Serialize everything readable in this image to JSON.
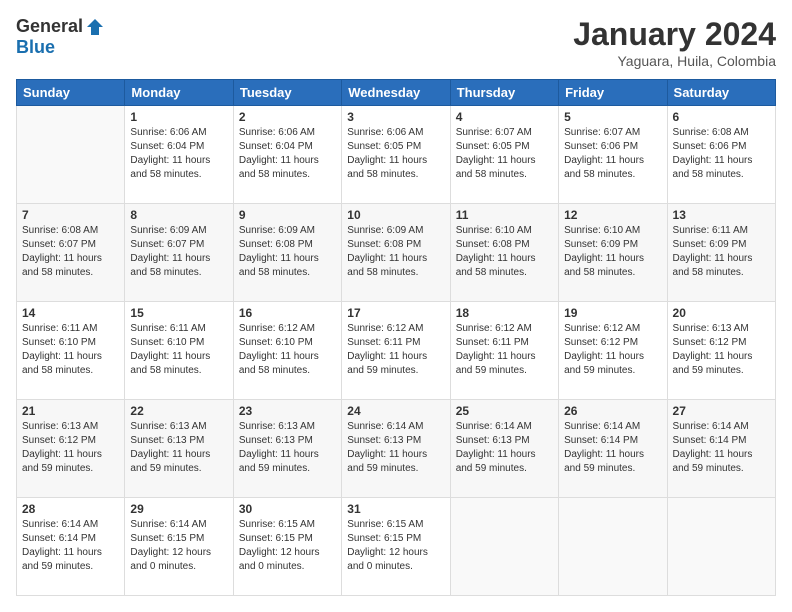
{
  "header": {
    "logo_general": "General",
    "logo_blue": "Blue",
    "month_title": "January 2024",
    "location": "Yaguara, Huila, Colombia"
  },
  "calendar": {
    "days_of_week": [
      "Sunday",
      "Monday",
      "Tuesday",
      "Wednesday",
      "Thursday",
      "Friday",
      "Saturday"
    ],
    "weeks": [
      [
        {
          "day": "",
          "info": ""
        },
        {
          "day": "1",
          "info": "Sunrise: 6:06 AM\nSunset: 6:04 PM\nDaylight: 11 hours\nand 58 minutes."
        },
        {
          "day": "2",
          "info": "Sunrise: 6:06 AM\nSunset: 6:04 PM\nDaylight: 11 hours\nand 58 minutes."
        },
        {
          "day": "3",
          "info": "Sunrise: 6:06 AM\nSunset: 6:05 PM\nDaylight: 11 hours\nand 58 minutes."
        },
        {
          "day": "4",
          "info": "Sunrise: 6:07 AM\nSunset: 6:05 PM\nDaylight: 11 hours\nand 58 minutes."
        },
        {
          "day": "5",
          "info": "Sunrise: 6:07 AM\nSunset: 6:06 PM\nDaylight: 11 hours\nand 58 minutes."
        },
        {
          "day": "6",
          "info": "Sunrise: 6:08 AM\nSunset: 6:06 PM\nDaylight: 11 hours\nand 58 minutes."
        }
      ],
      [
        {
          "day": "7",
          "info": "Sunrise: 6:08 AM\nSunset: 6:07 PM\nDaylight: 11 hours\nand 58 minutes."
        },
        {
          "day": "8",
          "info": "Sunrise: 6:09 AM\nSunset: 6:07 PM\nDaylight: 11 hours\nand 58 minutes."
        },
        {
          "day": "9",
          "info": "Sunrise: 6:09 AM\nSunset: 6:08 PM\nDaylight: 11 hours\nand 58 minutes."
        },
        {
          "day": "10",
          "info": "Sunrise: 6:09 AM\nSunset: 6:08 PM\nDaylight: 11 hours\nand 58 minutes."
        },
        {
          "day": "11",
          "info": "Sunrise: 6:10 AM\nSunset: 6:08 PM\nDaylight: 11 hours\nand 58 minutes."
        },
        {
          "day": "12",
          "info": "Sunrise: 6:10 AM\nSunset: 6:09 PM\nDaylight: 11 hours\nand 58 minutes."
        },
        {
          "day": "13",
          "info": "Sunrise: 6:11 AM\nSunset: 6:09 PM\nDaylight: 11 hours\nand 58 minutes."
        }
      ],
      [
        {
          "day": "14",
          "info": "Sunrise: 6:11 AM\nSunset: 6:10 PM\nDaylight: 11 hours\nand 58 minutes."
        },
        {
          "day": "15",
          "info": "Sunrise: 6:11 AM\nSunset: 6:10 PM\nDaylight: 11 hours\nand 58 minutes."
        },
        {
          "day": "16",
          "info": "Sunrise: 6:12 AM\nSunset: 6:10 PM\nDaylight: 11 hours\nand 58 minutes."
        },
        {
          "day": "17",
          "info": "Sunrise: 6:12 AM\nSunset: 6:11 PM\nDaylight: 11 hours\nand 59 minutes."
        },
        {
          "day": "18",
          "info": "Sunrise: 6:12 AM\nSunset: 6:11 PM\nDaylight: 11 hours\nand 59 minutes."
        },
        {
          "day": "19",
          "info": "Sunrise: 6:12 AM\nSunset: 6:12 PM\nDaylight: 11 hours\nand 59 minutes."
        },
        {
          "day": "20",
          "info": "Sunrise: 6:13 AM\nSunset: 6:12 PM\nDaylight: 11 hours\nand 59 minutes."
        }
      ],
      [
        {
          "day": "21",
          "info": "Sunrise: 6:13 AM\nSunset: 6:12 PM\nDaylight: 11 hours\nand 59 minutes."
        },
        {
          "day": "22",
          "info": "Sunrise: 6:13 AM\nSunset: 6:13 PM\nDaylight: 11 hours\nand 59 minutes."
        },
        {
          "day": "23",
          "info": "Sunrise: 6:13 AM\nSunset: 6:13 PM\nDaylight: 11 hours\nand 59 minutes."
        },
        {
          "day": "24",
          "info": "Sunrise: 6:14 AM\nSunset: 6:13 PM\nDaylight: 11 hours\nand 59 minutes."
        },
        {
          "day": "25",
          "info": "Sunrise: 6:14 AM\nSunset: 6:13 PM\nDaylight: 11 hours\nand 59 minutes."
        },
        {
          "day": "26",
          "info": "Sunrise: 6:14 AM\nSunset: 6:14 PM\nDaylight: 11 hours\nand 59 minutes."
        },
        {
          "day": "27",
          "info": "Sunrise: 6:14 AM\nSunset: 6:14 PM\nDaylight: 11 hours\nand 59 minutes."
        }
      ],
      [
        {
          "day": "28",
          "info": "Sunrise: 6:14 AM\nSunset: 6:14 PM\nDaylight: 11 hours\nand 59 minutes."
        },
        {
          "day": "29",
          "info": "Sunrise: 6:14 AM\nSunset: 6:15 PM\nDaylight: 12 hours\nand 0 minutes."
        },
        {
          "day": "30",
          "info": "Sunrise: 6:15 AM\nSunset: 6:15 PM\nDaylight: 12 hours\nand 0 minutes."
        },
        {
          "day": "31",
          "info": "Sunrise: 6:15 AM\nSunset: 6:15 PM\nDaylight: 12 hours\nand 0 minutes."
        },
        {
          "day": "",
          "info": ""
        },
        {
          "day": "",
          "info": ""
        },
        {
          "day": "",
          "info": ""
        }
      ]
    ]
  }
}
